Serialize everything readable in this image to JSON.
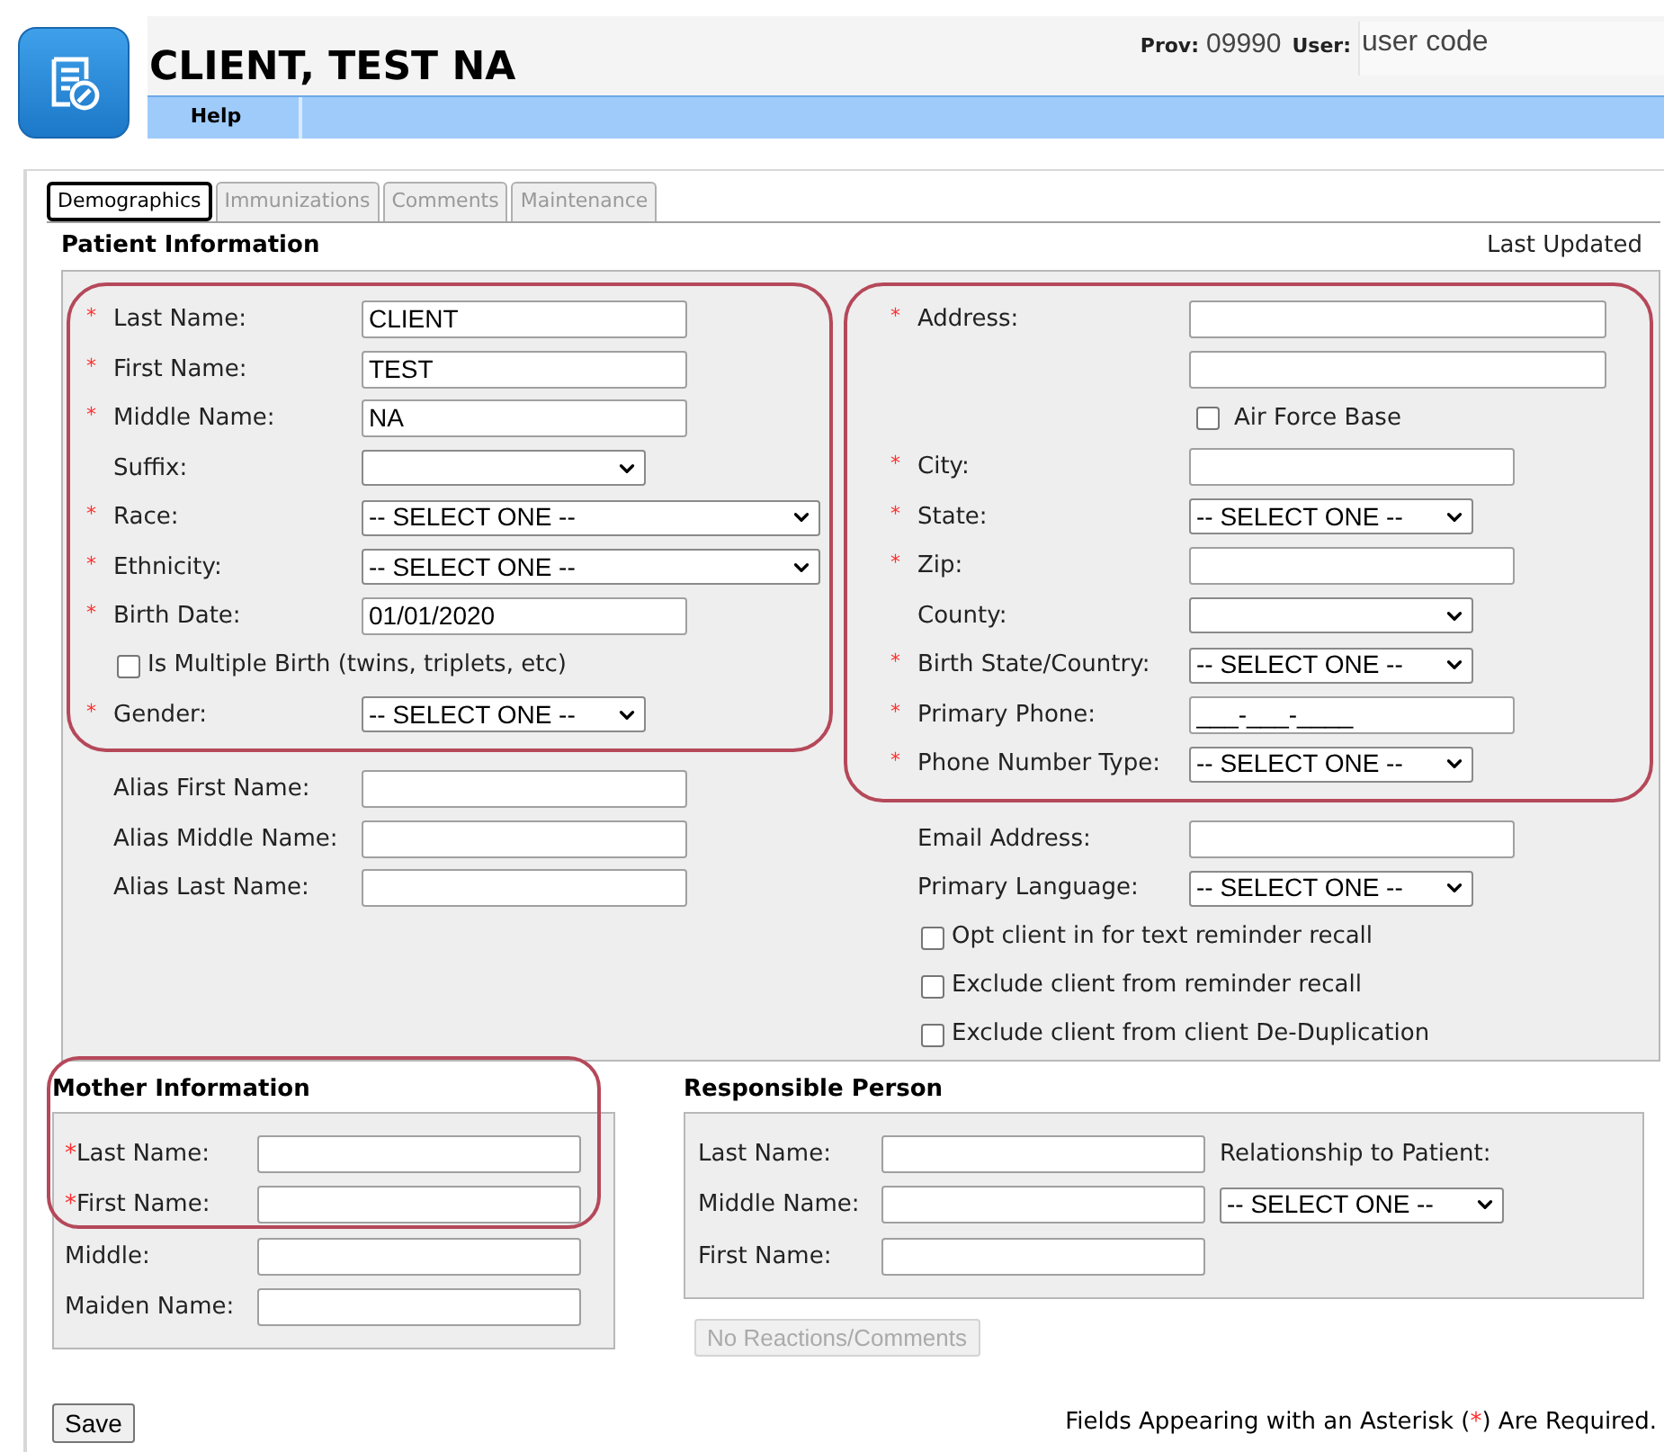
{
  "app": {
    "title": "CLIENT, TEST NA",
    "prov_label": "Prov:",
    "prov": "09990",
    "user_label": "User:",
    "user": "user code",
    "menu": [
      {
        "label": "Help"
      }
    ]
  },
  "tabs": [
    {
      "label": "Demographics",
      "selected": true
    },
    {
      "label": "Immunizations",
      "selected": false
    },
    {
      "label": "Comments",
      "selected": false
    },
    {
      "label": "Maintenance",
      "selected": false
    }
  ],
  "patient": {
    "title": "Patient Information",
    "last_updated": "Last Updated",
    "left": [
      {
        "highlighted": true,
        "rows": [
          {
            "kind": "text",
            "mark": "*",
            "label": "Last Name:",
            "value": "CLIENT"
          },
          {
            "kind": "text",
            "mark": "*",
            "label": "First Name:",
            "value": "TEST"
          },
          {
            "kind": "text",
            "mark": "*",
            "label": "Middle Name:",
            "value": "NA"
          },
          {
            "kind": "select",
            "label": "Suffix:"
          },
          {
            "kind": "wide_select",
            "mark": "*",
            "label": "Race:",
            "value": "-- SELECT ONE --"
          },
          {
            "kind": "wide_select",
            "mark": "*",
            "label": "Ethnicity:",
            "value": "-- SELECT ONE --"
          },
          {
            "kind": "text",
            "mark": "*",
            "label": "Birth Date:",
            "value": "01/01/2020"
          },
          {
            "kind": "checkbox",
            "label": "Is Multiple Birth (twins, triplets, etc)",
            "checked": false
          },
          {
            "kind": "select",
            "mark": "*",
            "label": "Gender:",
            "value": "-- SELECT ONE --"
          }
        ]
      },
      {
        "highlighted": false,
        "rows": [
          {
            "kind": "text",
            "label": "Alias First Name:"
          },
          {
            "kind": "text",
            "label": "Alias Middle Name:"
          },
          {
            "kind": "text",
            "label": "Alias Last Name:"
          }
        ]
      }
    ],
    "right": [
      {
        "highlighted": true,
        "rows": [
          {
            "kind": "long_text",
            "mark": "*",
            "label": "Address:"
          },
          {
            "kind": "long_text"
          },
          {
            "kind": "field_checkbox",
            "label": "Air Force Base",
            "checked": false
          },
          {
            "kind": "text",
            "mark": "*",
            "label": "City:"
          },
          {
            "kind": "select",
            "mark": "*",
            "label": "State:",
            "value": "-- SELECT ONE --"
          },
          {
            "kind": "text",
            "mark": "*",
            "label": "Zip:"
          },
          {
            "kind": "select",
            "label": "County:"
          },
          {
            "kind": "select",
            "mark": "*",
            "label": "Birth State/Country:",
            "value": "-- SELECT ONE --"
          },
          {
            "kind": "text",
            "mark": "*",
            "label": "Primary Phone:",
            "value": "___-___-____"
          },
          {
            "kind": "select",
            "mark": "*",
            "label": "Phone Number Type:",
            "value": "-- SELECT ONE --"
          }
        ]
      },
      {
        "highlighted": false,
        "rows": [
          {
            "kind": "text",
            "label": "Email Address:"
          },
          {
            "kind": "select",
            "label": "Primary Language:",
            "value": "-- SELECT ONE --"
          },
          {
            "kind": "checkbox",
            "label": "Opt client in for text reminder recall",
            "checked": false
          },
          {
            "kind": "checkbox",
            "label": "Exclude client from reminder recall",
            "checked": false
          },
          {
            "kind": "checkbox",
            "label": "Exclude client from client De-Duplication",
            "checked": false
          }
        ]
      }
    ]
  },
  "mother": {
    "title": "Mother Information",
    "highlighted": true,
    "rows": [
      {
        "mark": "*",
        "label": "Last Name:"
      },
      {
        "mark": "*",
        "label": "First Name:"
      },
      {
        "label": "Middle:"
      },
      {
        "label": "Maiden Name:"
      }
    ]
  },
  "responsible": {
    "title": "Responsible Person",
    "rows": [
      {
        "label": "Last Name:"
      },
      {
        "label": "Middle Name:"
      },
      {
        "label": "First Name:"
      }
    ],
    "relationship_label": "Relationship to Patient:",
    "relationship_value": "-- SELECT ONE --"
  },
  "reactions_button": {
    "label": "No Reactions/Comments",
    "disabled": true
  },
  "save_button": {
    "label": "Save"
  },
  "required_note": {
    "before": "Fields Appearing with an Asterisk (",
    "mark": "*",
    "after": ") Are Required."
  }
}
